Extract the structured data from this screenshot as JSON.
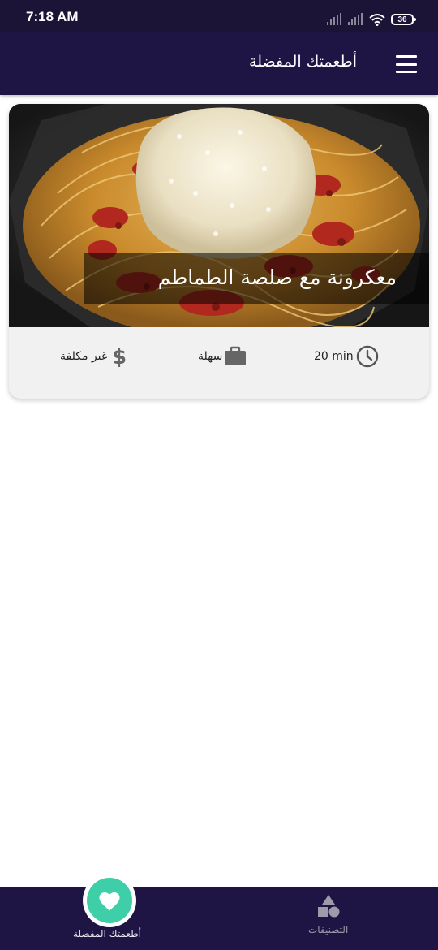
{
  "status_bar": {
    "time": "7:18 AM",
    "battery": "36",
    "icons": [
      "signal-icon",
      "signal-icon",
      "wifi-icon",
      "battery-icon"
    ]
  },
  "app_bar": {
    "title": "أطعمتك المفضلة",
    "menu_icon": "menu-icon"
  },
  "meal_card": {
    "title": "معكرونة مع صلصة الطماطم",
    "image": "spaghetti-bolognese-photo",
    "duration": "20 min",
    "complexity": "سهلة",
    "affordability": "غير مكلفة",
    "icons": {
      "duration": "clock-icon",
      "complexity": "briefcase-icon",
      "affordability": "dollar-icon"
    }
  },
  "bottom_nav": {
    "items": [
      {
        "label": "أطعمتك المفضلة",
        "icon": "heart-icon",
        "active": true
      },
      {
        "label": "التصنيفات",
        "icon": "category-icon",
        "active": false
      }
    ]
  },
  "colors": {
    "primary_dark": "#1f1545",
    "accent": "#3ecfa8",
    "nav_inactive": "#9e9aa9",
    "card_background": "#f1f1f1"
  }
}
